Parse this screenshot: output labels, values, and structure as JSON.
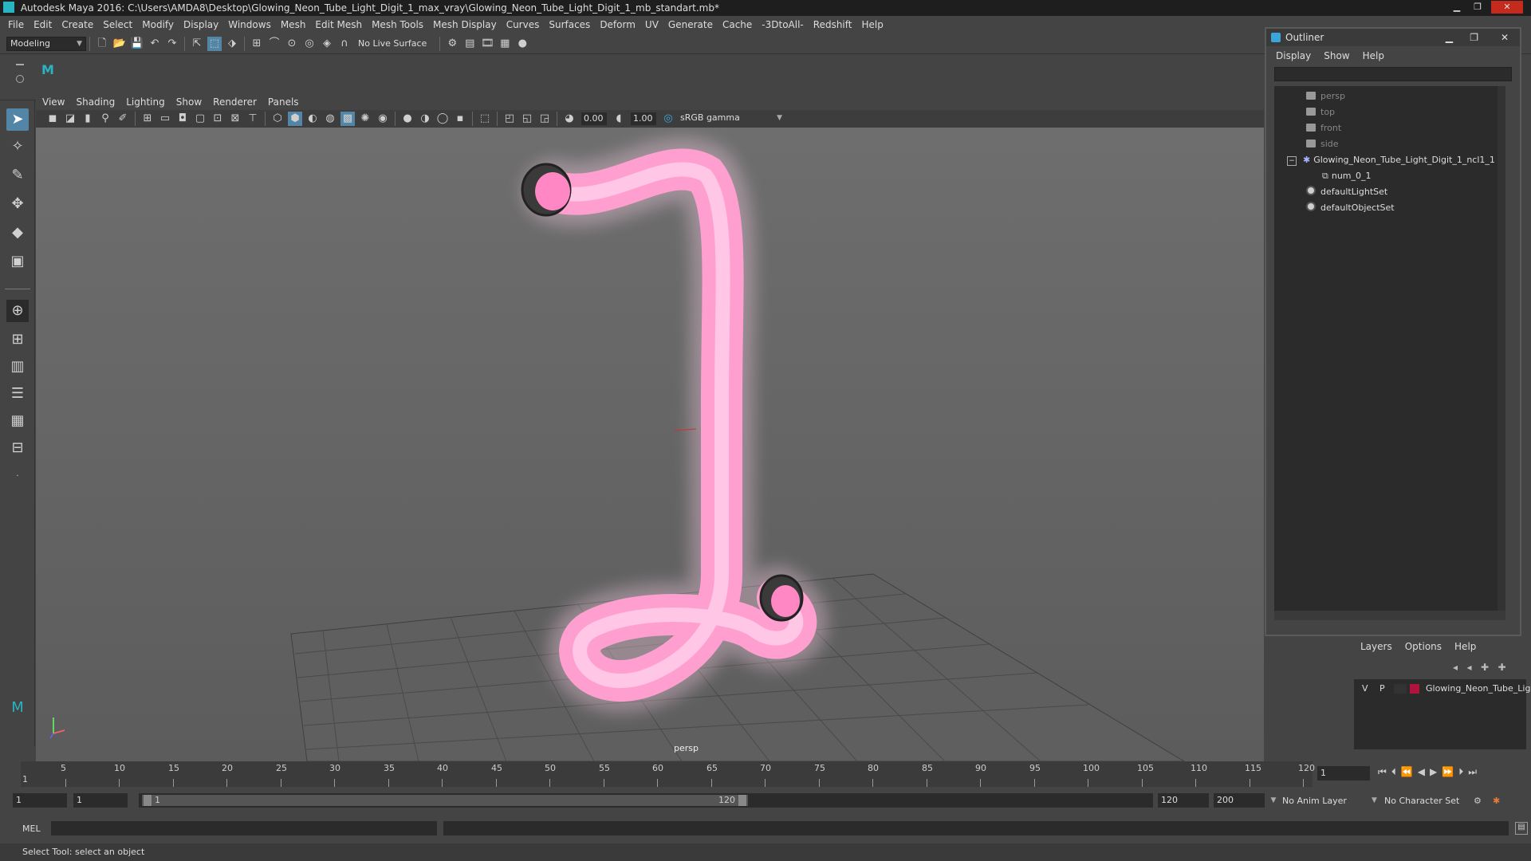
{
  "app": {
    "title": "Autodesk Maya 2016: C:\\Users\\AMDA8\\Desktop\\Glowing_Neon_Tube_Light_Digit_1_max_vray\\Glowing_Neon_Tube_Light_Digit_1_mb_standart.mb*"
  },
  "menubar": [
    "File",
    "Edit",
    "Create",
    "Select",
    "Modify",
    "Display",
    "Windows",
    "Mesh",
    "Edit Mesh",
    "Mesh Tools",
    "Mesh Display",
    "Curves",
    "Surfaces",
    "Deform",
    "UV",
    "Generate",
    "Cache",
    "-3DtoAll-",
    "Redshift",
    "Help"
  ],
  "toolbar": {
    "mode": "Modeling",
    "live_surface": "No Live Surface"
  },
  "panel": {
    "menus": [
      "View",
      "Shading",
      "Lighting",
      "Show",
      "Renderer",
      "Panels"
    ],
    "exposure": "0.00",
    "gamma": "1.00",
    "color_space": "sRGB gamma",
    "camera_label": "persp"
  },
  "outliner": {
    "title": "Outliner",
    "menus": [
      "Display",
      "Show",
      "Help"
    ],
    "items": [
      {
        "label": "persp",
        "type": "camera"
      },
      {
        "label": "top",
        "type": "camera"
      },
      {
        "label": "front",
        "type": "camera"
      },
      {
        "label": "side",
        "type": "camera"
      },
      {
        "label": "Glowing_Neon_Tube_Light_Digit_1_ncl1_1",
        "type": "group"
      },
      {
        "label": "num_0_1",
        "type": "mesh"
      },
      {
        "label": "defaultLightSet",
        "type": "set"
      },
      {
        "label": "defaultObjectSet",
        "type": "set"
      }
    ]
  },
  "layers": {
    "menus": [
      "Layers",
      "Options",
      "Help"
    ],
    "row": {
      "v": "V",
      "p": "P",
      "name": "Glowing_Neon_Tube_Lig"
    },
    "color": "#b0143c"
  },
  "timeline": {
    "ticks": [
      5,
      10,
      15,
      20,
      25,
      30,
      35,
      40,
      45,
      50,
      55,
      60,
      65,
      70,
      75,
      80,
      85,
      90,
      95,
      100,
      105,
      110,
      115,
      120
    ],
    "first_label": "1",
    "current_frame": "1"
  },
  "range": {
    "start": "1",
    "playback_start": "1",
    "slider_start": "1",
    "slider_end": "120",
    "playback_end": "120",
    "end": "200",
    "anim_layer": "No Anim Layer",
    "character_set": "No Character Set"
  },
  "cmdline": {
    "label": "MEL"
  },
  "helpline": {
    "text": "Select Tool: select an object"
  },
  "colors": {
    "neon": "#ff9fd0",
    "accent": "#5285a6"
  }
}
